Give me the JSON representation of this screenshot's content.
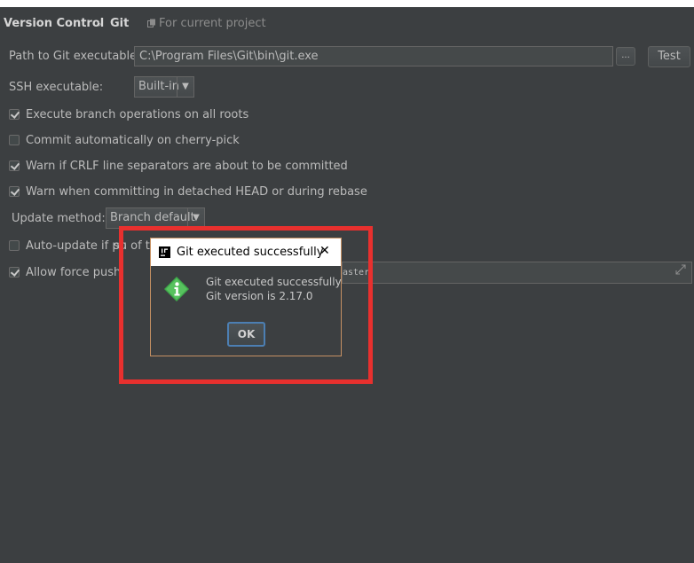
{
  "breadcrumb": {
    "section": "Version Control",
    "separator": "›",
    "page": "Git",
    "scope": "For current project"
  },
  "git_path": {
    "label": "Path to Git executable:",
    "value": "C:\\Program Files\\Git\\bin\\git.exe",
    "browse_label": "...",
    "test_label": "Test"
  },
  "ssh": {
    "label": "SSH executable:",
    "selected": "Built-in"
  },
  "options": [
    {
      "label": "Execute branch operations on all roots",
      "checked": true
    },
    {
      "label": "Commit automatically on cherry-pick",
      "checked": false
    },
    {
      "label": "Warn if CRLF line separators are about to be committed",
      "checked": true
    },
    {
      "label": "Warn when committing in detached HEAD or during rebase",
      "checked": true
    }
  ],
  "update_method": {
    "label": "Update method:",
    "selected": "Branch default"
  },
  "auto_update": {
    "label_visible": "Auto-update if pu",
    "label_trailing": "sh of t",
    "checked": false
  },
  "force_push": {
    "label": "Allow force push",
    "checked": true,
    "field_visible": "aster"
  },
  "dialog": {
    "title": "Git executed successfully",
    "close_glyph": "✕",
    "line1": "Git executed successfully",
    "line2": "Git version is 2.17.0",
    "ok_label": "OK",
    "icon": "info-icon",
    "border_color": "#c69163",
    "highlight_color": "#e8302e"
  }
}
